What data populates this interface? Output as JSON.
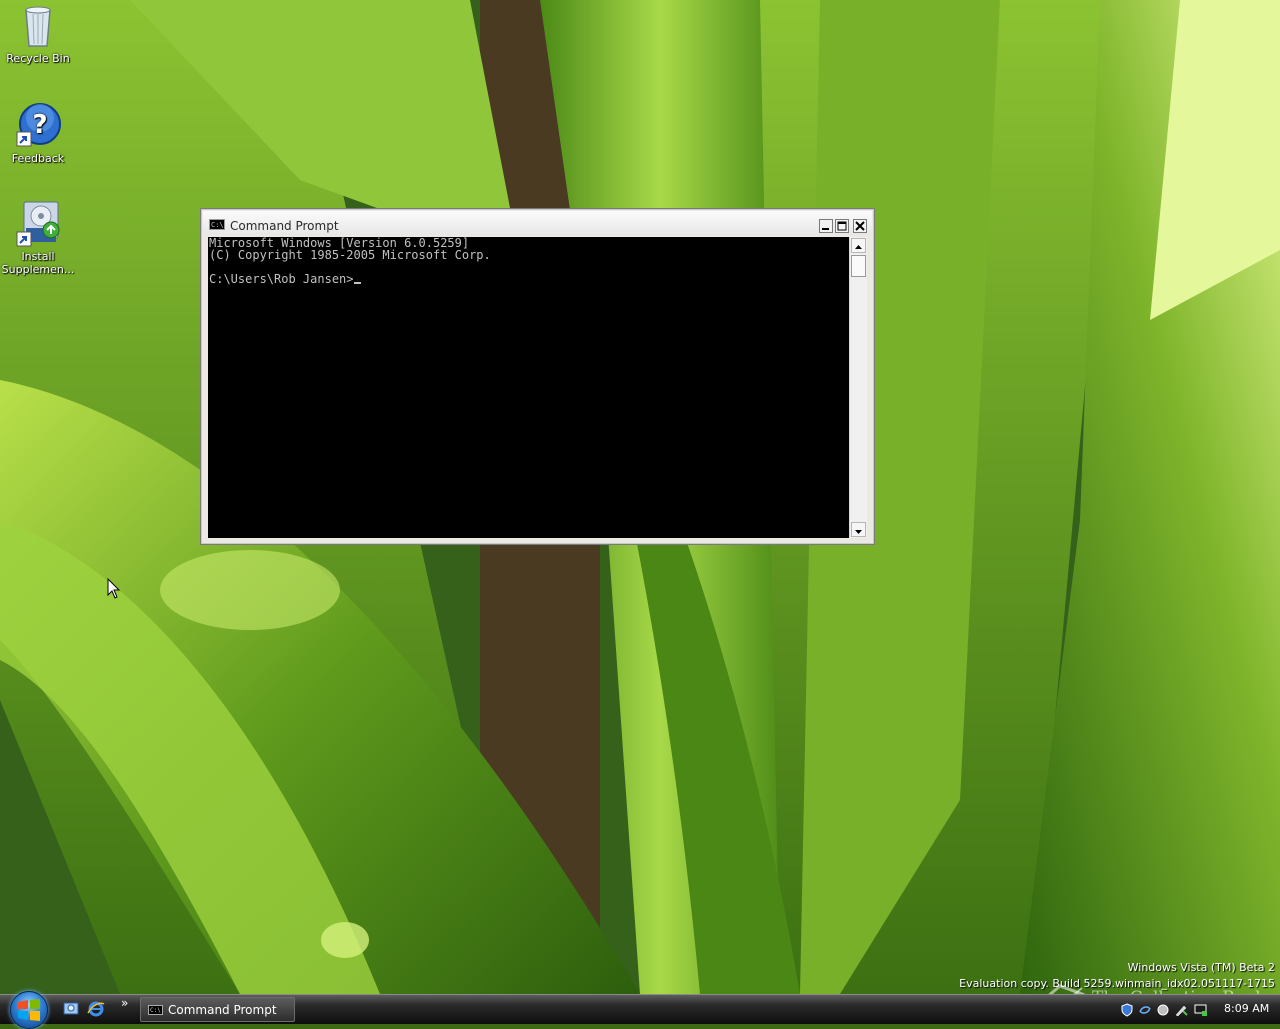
{
  "desktop": {
    "icons": [
      {
        "label": "Recycle Bin",
        "icon": "recycle-bin-icon"
      },
      {
        "label": "Feedback",
        "icon": "help-feedback-icon"
      },
      {
        "label_line1": "Install",
        "label_line2": "Supplemen...",
        "icon": "install-supplemental-icon"
      }
    ]
  },
  "cmd_window": {
    "title": "Command Prompt",
    "title_icon_text": "C:\\",
    "lines": [
      "Microsoft Windows [Version 6.0.5259]",
      "(C) Copyright 1985-2005 Microsoft Corp.",
      "",
      "C:\\Users\\Rob Jansen>"
    ]
  },
  "watermark": {
    "line1": "Windows Vista (TM) Beta 2",
    "line2": "Evaluation copy. Build 5259.winmain_idx02.051117-1715",
    "overlay_text": "The Collection Book"
  },
  "taskbar": {
    "quick_launch": [
      "show-desktop-icon",
      "internet-explorer-icon"
    ],
    "chevron": "»",
    "tasks": [
      {
        "label": "Command Prompt",
        "icon_text": "C:\\"
      }
    ],
    "clock": "8:09 AM"
  },
  "colors": {
    "console_bg": "#000000",
    "console_text": "#c0c0c0",
    "taskbar": "#1a1a1a",
    "wallpaper_leaf": "#6aa321"
  }
}
